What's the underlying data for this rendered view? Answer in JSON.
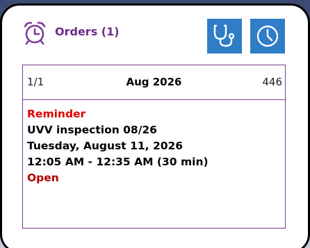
{
  "header": {
    "icon": "alarm-clock-icon",
    "title": "Orders (1)",
    "accent_color": "#6c2d86",
    "buttons": [
      {
        "icon": "stethoscope-icon",
        "color": "#2f7dc7"
      },
      {
        "icon": "clock-icon",
        "color": "#2f7dc7"
      }
    ]
  },
  "card": {
    "counter": "1/1",
    "month": "Aug 2026",
    "number": "446",
    "label": "Reminder",
    "title": "UVV inspection 08/26",
    "date": "Tuesday, August 11, 2026",
    "time": "12:05 AM - 12:35 AM (30 min)",
    "status": "Open",
    "border_color": "#7b3a8a",
    "label_color": "#e00000",
    "status_color": "#b00000"
  }
}
